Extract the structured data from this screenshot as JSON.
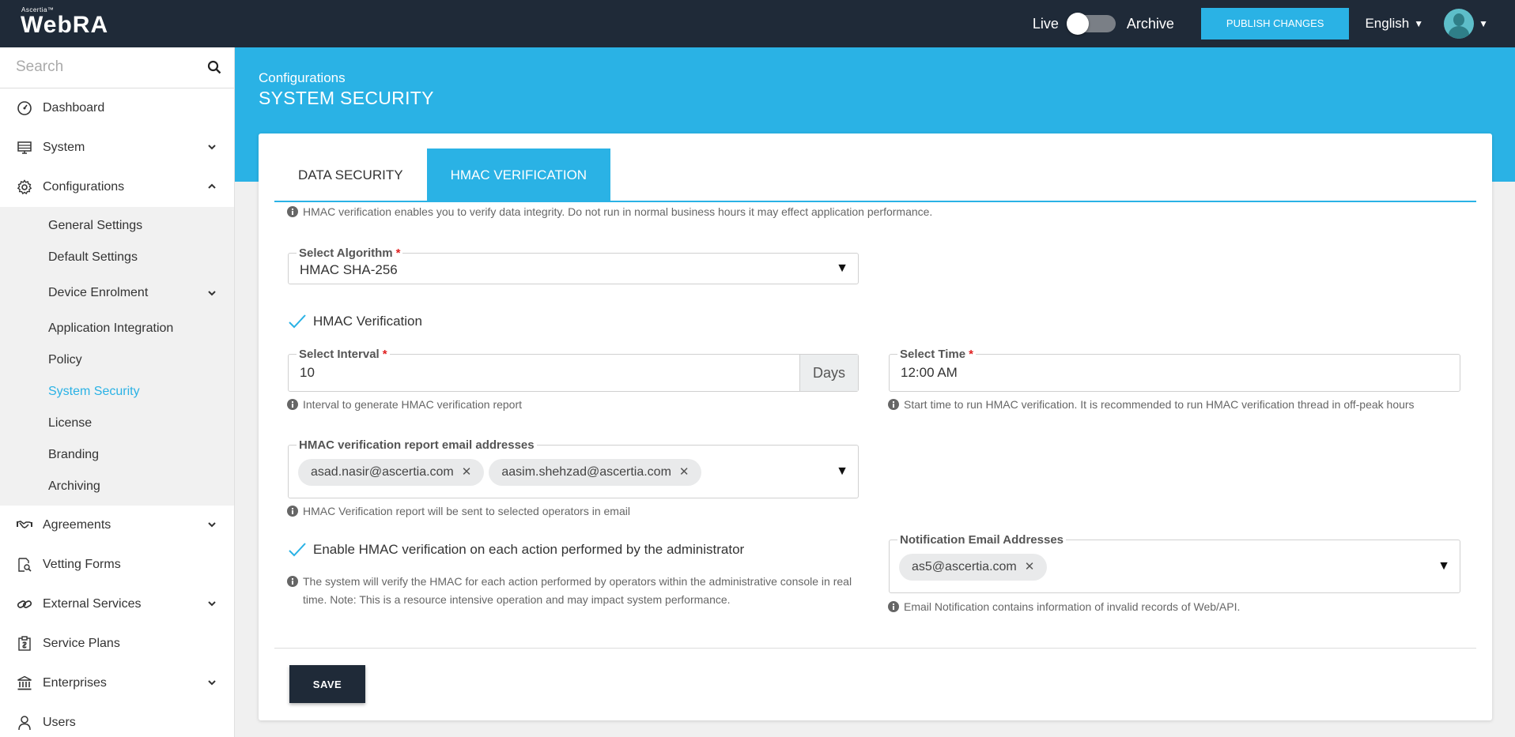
{
  "app": {
    "logo_tm": "Ascertia™",
    "logo_name": "WebRA"
  },
  "topbar": {
    "live_label": "Live",
    "archive_label": "Archive",
    "publish_label": "PUBLISH CHANGES",
    "language": "English"
  },
  "sidebar": {
    "search_placeholder": "Search",
    "items": [
      {
        "label": "Dashboard",
        "icon": "dashboard-icon"
      },
      {
        "label": "System",
        "icon": "system-icon"
      },
      {
        "label": "Configurations",
        "icon": "gear-icon"
      },
      {
        "label": "Agreements",
        "icon": "handshake-icon"
      },
      {
        "label": "Vetting Forms",
        "icon": "form-search-icon"
      },
      {
        "label": "External Services",
        "icon": "link-icon"
      },
      {
        "label": "Service Plans",
        "icon": "service-plan-icon"
      },
      {
        "label": "Enterprises",
        "icon": "bank-icon"
      },
      {
        "label": "Users",
        "icon": "user-icon"
      }
    ],
    "config_sub": [
      "General Settings",
      "Default Settings",
      "Device Enrolment",
      "Application Integration",
      "Policy",
      "System Security",
      "License",
      "Branding",
      "Archiving"
    ]
  },
  "page": {
    "breadcrumb": "Configurations",
    "title": "SYSTEM SECURITY"
  },
  "tabs": [
    "DATA SECURITY",
    "HMAC VERIFICATION"
  ],
  "form": {
    "intro": "HMAC verification enables you to verify data integrity. Do not run in normal business hours it may effect application performance.",
    "algorithm_label": "Select Algorithm",
    "algorithm_value": "HMAC SHA-256",
    "hmac_check_label": "HMAC Verification",
    "interval_label": "Select Interval",
    "interval_value": "10",
    "interval_unit": "Days",
    "interval_help": "Interval to generate HMAC verification report",
    "time_label": "Select Time",
    "time_value": "12:00 AM",
    "time_help": "Start time to run HMAC verification. It is recommended to run HMAC verification thread in off-peak hours",
    "report_emails_label": "HMAC verification report email addresses",
    "report_emails": [
      "asad.nasir@ascertia.com",
      "aasim.shehzad@ascertia.com"
    ],
    "report_emails_help": "HMAC Verification report will be sent to selected operators in email",
    "admin_check_label": "Enable HMAC verification on each action performed by the administrator",
    "admin_help": "The system will verify the HMAC for each action performed by operators within the administrative console in real time. Note: This is a resource intensive operation and may impact system performance.",
    "notify_label": "Notification Email Addresses",
    "notify_emails": [
      "as5@ascertia.com"
    ],
    "notify_help": "Email Notification contains information of invalid records of Web/API.",
    "save_label": "SAVE"
  },
  "colors": {
    "accent": "#2ab2e5",
    "topbar": "#1f2a38",
    "required": "#e02020"
  }
}
